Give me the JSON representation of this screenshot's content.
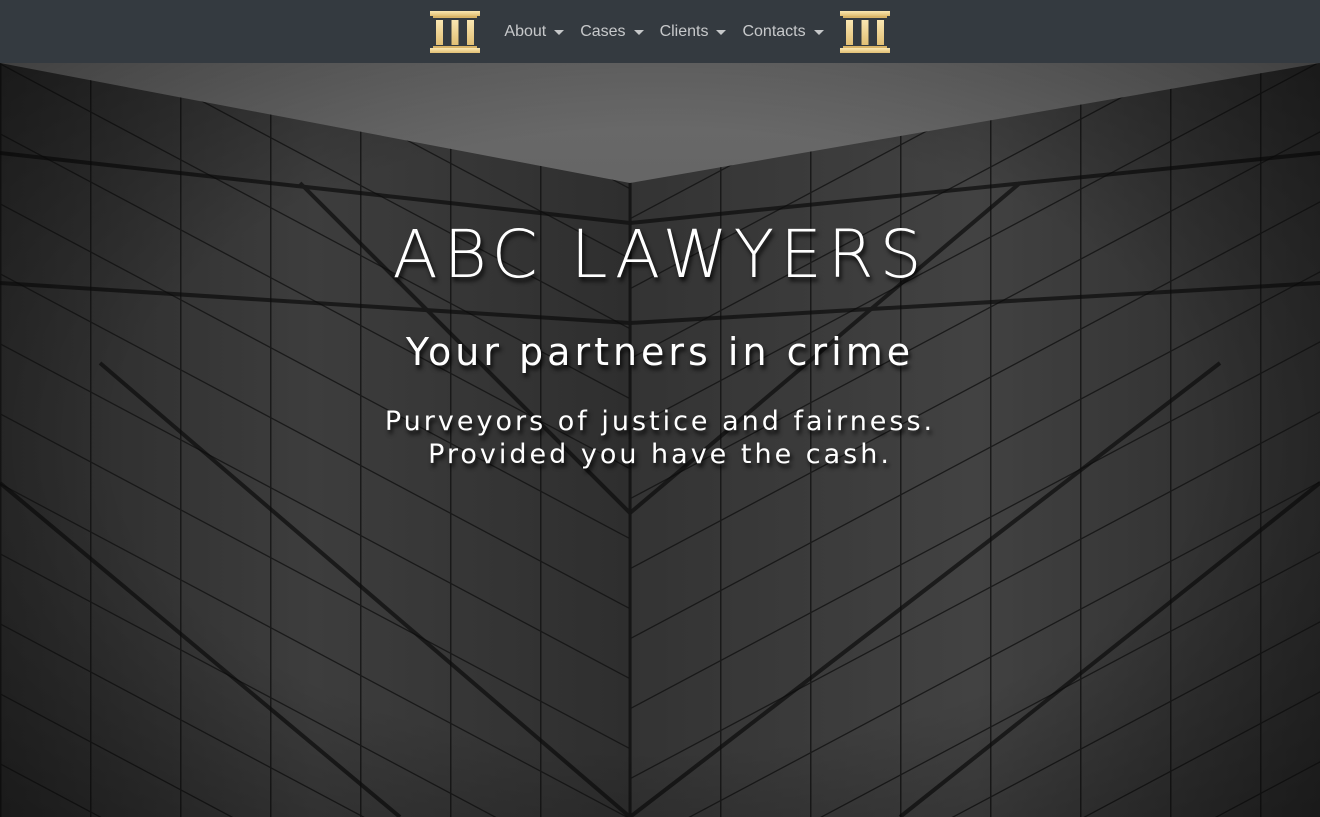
{
  "navbar": {
    "logo_left_icon": "pillars-logo-icon",
    "logo_right_icon": "pillars-logo-icon",
    "logo_color": "#f5d88f",
    "background_color": "#343a40",
    "items": [
      {
        "label": "About"
      },
      {
        "label": "Cases"
      },
      {
        "label": "Clients"
      },
      {
        "label": "Contacts"
      }
    ]
  },
  "hero": {
    "background": "skyscraper-glass-facade-image",
    "title": "ABC LAWYERS",
    "tagline": "Your partners in crime",
    "description_line1": "Purveyors of justice and fairness.",
    "description_line2": "Provided you have the cash."
  }
}
